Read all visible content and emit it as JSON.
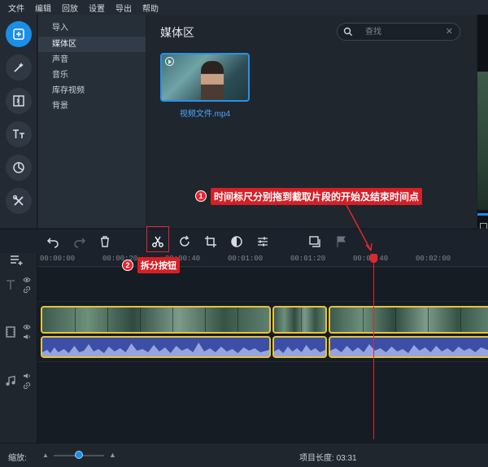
{
  "menu": [
    "文件",
    "编辑",
    "回放",
    "设置",
    "导出",
    "帮助"
  ],
  "rail": [
    {
      "icon": "import-plus-icon",
      "active": true
    },
    {
      "icon": "magic-wand-icon",
      "active": false
    },
    {
      "icon": "transitions-icon",
      "active": false
    },
    {
      "icon": "titles-icon",
      "active": false
    },
    {
      "icon": "stickers-icon",
      "active": false
    },
    {
      "icon": "tools-icon",
      "active": false
    }
  ],
  "categories": [
    "导入",
    "媒体区",
    "声音",
    "音乐",
    "库存视频",
    "背景"
  ],
  "selected_category": "媒体区",
  "media": {
    "title": "媒体区",
    "search_placeholder": "查找",
    "clear_glyph": "✕",
    "file_name": "视频文件.mp4"
  },
  "annotations": {
    "one_num": "1",
    "one_text": "时间标尺分别拖到截取片段的开始及结束时间点",
    "two_num": "2",
    "two_text": "拆分按钮"
  },
  "ruler": [
    "00:00:00",
    "00:00:20",
    "00:00:40",
    "00:01:00",
    "00:01:20",
    "00:01:40",
    "00:02:00"
  ],
  "status": {
    "zoom_label": "缩放:",
    "project_length_label": "项目长度:",
    "project_length": "03:31"
  },
  "colors": {
    "accent": "#1b8ee8",
    "annotation_red": "#e3262d",
    "clip_border": "#e8c23a",
    "audio_fill": "#3c4fa6"
  }
}
